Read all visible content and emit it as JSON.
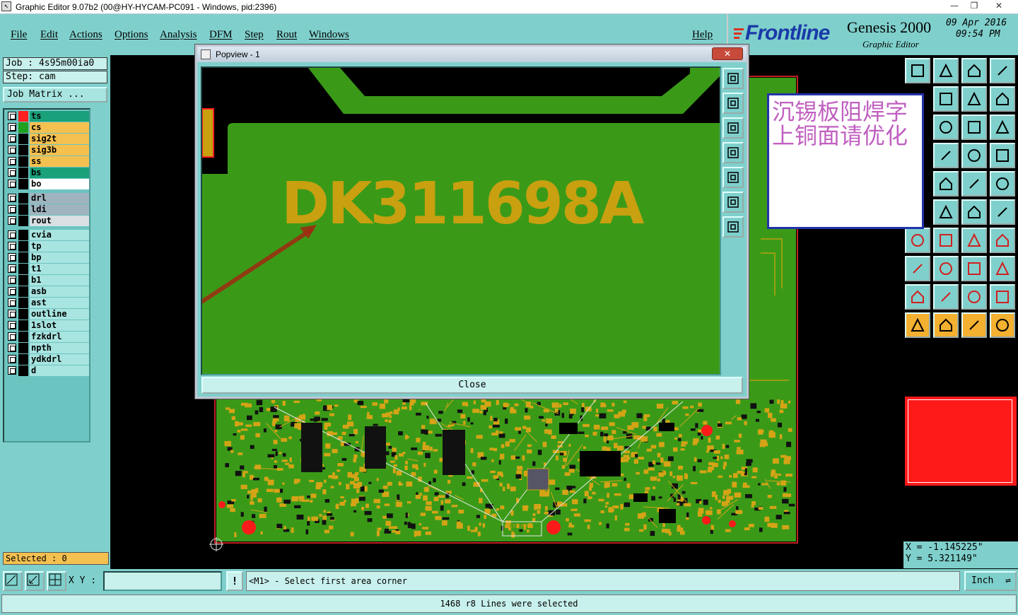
{
  "window": {
    "title": "Graphic Editor 9.07b2 (00@HY-HYCAM-PC091 - Windows, pid:2396)",
    "min_icon": "minimize-icon",
    "max_icon": "maximize-icon",
    "close_label": "✕"
  },
  "menu": {
    "items": [
      "File",
      "Edit",
      "Actions",
      "Options",
      "Analysis",
      "DFM",
      "Step",
      "Rout",
      "Windows"
    ],
    "help": "Help"
  },
  "brand": {
    "logo": "Frontline",
    "product": "Genesis 2000",
    "subtitle": "Graphic Editor",
    "date": "09 Apr 2016",
    "time": "09:54 PM"
  },
  "job": {
    "job_line": "Job : 4s95m00ia0",
    "step_line": "Step: cam",
    "matrix_button": "Job Matrix ..."
  },
  "layers": [
    {
      "name": "ts",
      "color": "#1aa07a",
      "swatch": "#ff2020"
    },
    {
      "name": "cs",
      "color": "#f4c050",
      "swatch": "#20a020"
    },
    {
      "name": "sig2t",
      "color": "#f4c050",
      "swatch": "#000000"
    },
    {
      "name": "sig3b",
      "color": "#f4c050",
      "swatch": "#000000"
    },
    {
      "name": "ss",
      "color": "#f4c050",
      "swatch": "#000000"
    },
    {
      "name": "bs",
      "color": "#1aa07a",
      "swatch": "#000000"
    },
    {
      "name": "bo",
      "color": "#ffffff",
      "swatch": "#000000"
    },
    {
      "name": "drl",
      "color": "#a0b4c0",
      "swatch": "#000000"
    },
    {
      "name": "ldi",
      "color": "#a0b4c0",
      "swatch": "#000000"
    },
    {
      "name": "rout",
      "color": "#d8e0e4",
      "swatch": "#000000"
    },
    {
      "name": "cvia",
      "color": "#a8e4e0",
      "swatch": "#000000"
    },
    {
      "name": "tp",
      "color": "#a8e4e0",
      "swatch": "#000000"
    },
    {
      "name": "bp",
      "color": "#a8e4e0",
      "swatch": "#000000"
    },
    {
      "name": "t1",
      "color": "#a8e4e0",
      "swatch": "#000000"
    },
    {
      "name": "b1",
      "color": "#a8e4e0",
      "swatch": "#000000"
    },
    {
      "name": "asb",
      "color": "#a8e4e0",
      "swatch": "#000000"
    },
    {
      "name": "ast",
      "color": "#a8e4e0",
      "swatch": "#000000"
    },
    {
      "name": "outline",
      "color": "#a8e4e0",
      "swatch": "#000000"
    },
    {
      "name": "1slot",
      "color": "#a8e4e0",
      "swatch": "#000000"
    },
    {
      "name": "fzkdrl",
      "color": "#a8e4e0",
      "swatch": "#000000"
    },
    {
      "name": "npth",
      "color": "#a8e4e0",
      "swatch": "#000000"
    },
    {
      "name": "ydkdrl",
      "color": "#a8e4e0",
      "swatch": "#000000"
    },
    {
      "name": "d",
      "color": "#a8e4e0",
      "swatch": "#000000"
    }
  ],
  "selected": "Selected : 0",
  "popview": {
    "title": "Popview - 1",
    "close_x": "✕",
    "silk_text": "DK311698A",
    "close_button": "Close"
  },
  "board": {
    "small_label": "DK311698A"
  },
  "note": {
    "line1": "沉锡板阻焊字",
    "line2": "上铜面请优化"
  },
  "coords": {
    "x": "X = -1.145225\"",
    "y": "Y = 5.321149\""
  },
  "bottom": {
    "xy_label": "X Y :",
    "xy_value": "",
    "bang": "!",
    "prompt": "<M1> - Select first area corner",
    "unit": "Inch",
    "status": "1468 r8 Lines were selected"
  },
  "colors": {
    "panel": "#7fd0cc",
    "board_green": "#3a9a18",
    "silk_yellow": "#c8a010",
    "accent_red": "#ff1a1a"
  }
}
